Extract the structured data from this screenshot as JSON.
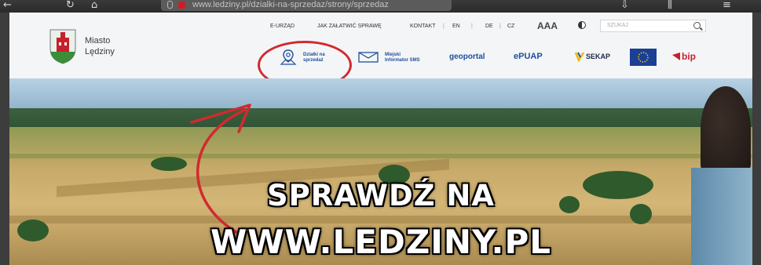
{
  "browser": {
    "url": "www.ledziny.pl/dzialki-na-sprzedaz/strony/sprzedaz"
  },
  "site": {
    "logo": {
      "line1": "Miasto",
      "line2": "Lędziny"
    },
    "topnav": [
      "E-URZĄD",
      "JAK ZAŁATWIĆ SPRAWĘ",
      "KONTAKT",
      "EN",
      "DE",
      "CZ"
    ],
    "font_size_control": "AAA",
    "search_placeholder": "SZUKAJ",
    "quick_links": {
      "dzialki": {
        "line1": "Działki na",
        "line2": "sprzedaż"
      },
      "sms": {
        "line1": "Miejski",
        "line2": "Informator SMS"
      },
      "geoportal": "geoportal",
      "epuap": "ePUAP",
      "sekap": "SEKAP",
      "bip": "bip"
    }
  },
  "banner": {
    "line1": "SPRAWDŹ NA",
    "line2": "WWW.LEDZINY.PL"
  },
  "colors": {
    "accent_red": "#d12a2f",
    "link_blue": "#1d4f9c",
    "eu_blue": "#1b3f95"
  }
}
